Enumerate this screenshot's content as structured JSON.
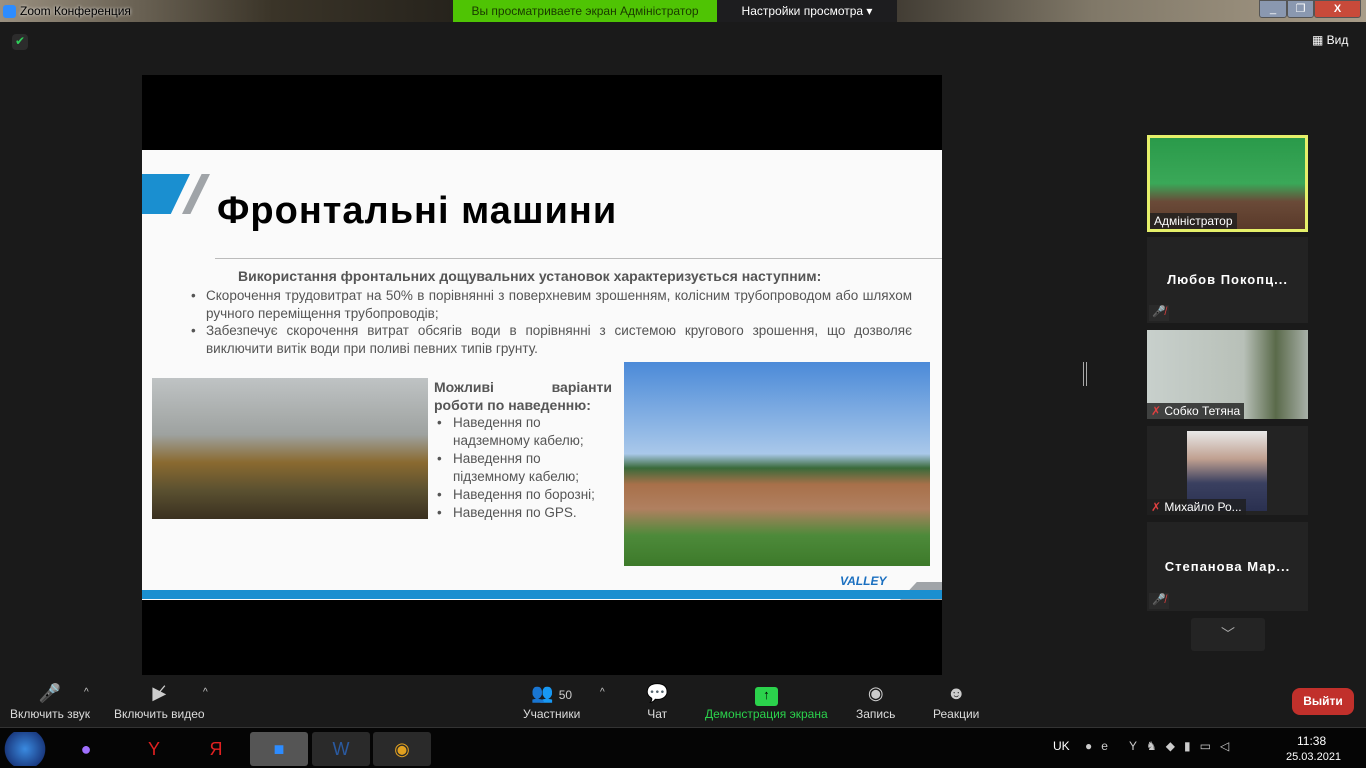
{
  "window": {
    "title": "Zoom Конференция",
    "minimize": "_",
    "restore": "❐",
    "close": "X"
  },
  "banner": {
    "text": "Вы просматриваете экран Адміністратор",
    "view_settings": "Настройки просмотра ▾"
  },
  "top": {
    "view_label": "Вид"
  },
  "slide": {
    "title": "Фронтальні машини",
    "intro": "Використання фронтальних дощувальних установок характеризується наступним:",
    "bullets": [
      "Скорочення трудовитрат на 50% в порівнянні з поверхневим зрошенням, колісним трубопроводом або шляхом ручного переміщення трубопроводів;",
      "Забезпечує скорочення витрат обсягів води в порівнянні з системою кругового зрошення, що дозволяє виключити витік води при поливі певних типів грунту."
    ],
    "modes_heading_1": "Можливі варіанти",
    "modes_heading_2": "роботи по наведенню:",
    "modes": [
      "Наведення по надземному кабелю;",
      "Наведення по підземному кабелю;",
      "Наведення по борозні;",
      "Наведення по GPS."
    ],
    "logo": "VALLEY"
  },
  "participants_panel": [
    {
      "name": "Адміністратор",
      "video": true,
      "active": true
    },
    {
      "name": "Любов  Покопц...",
      "video": false,
      "muted": true
    },
    {
      "name": "Собко Тетяна",
      "video": true,
      "muted": true
    },
    {
      "name": "Михайло Ро...",
      "video": true,
      "muted": true
    },
    {
      "name": "Степанова  Мар...",
      "video": false,
      "muted": true
    }
  ],
  "toolbar": {
    "unmute": "Включить звук",
    "start_video": "Включить видео",
    "participants": "Участники",
    "participants_count": "50",
    "chat": "Чат",
    "share": "Демонстрация экрана",
    "record": "Запись",
    "reactions": "Реакции",
    "leave": "Выйти",
    "share_color": "#2bd24c",
    "leave_color": "#c1302b"
  },
  "taskbar": {
    "lang": "UK",
    "time": "11:38",
    "date": "25.03.2021"
  }
}
